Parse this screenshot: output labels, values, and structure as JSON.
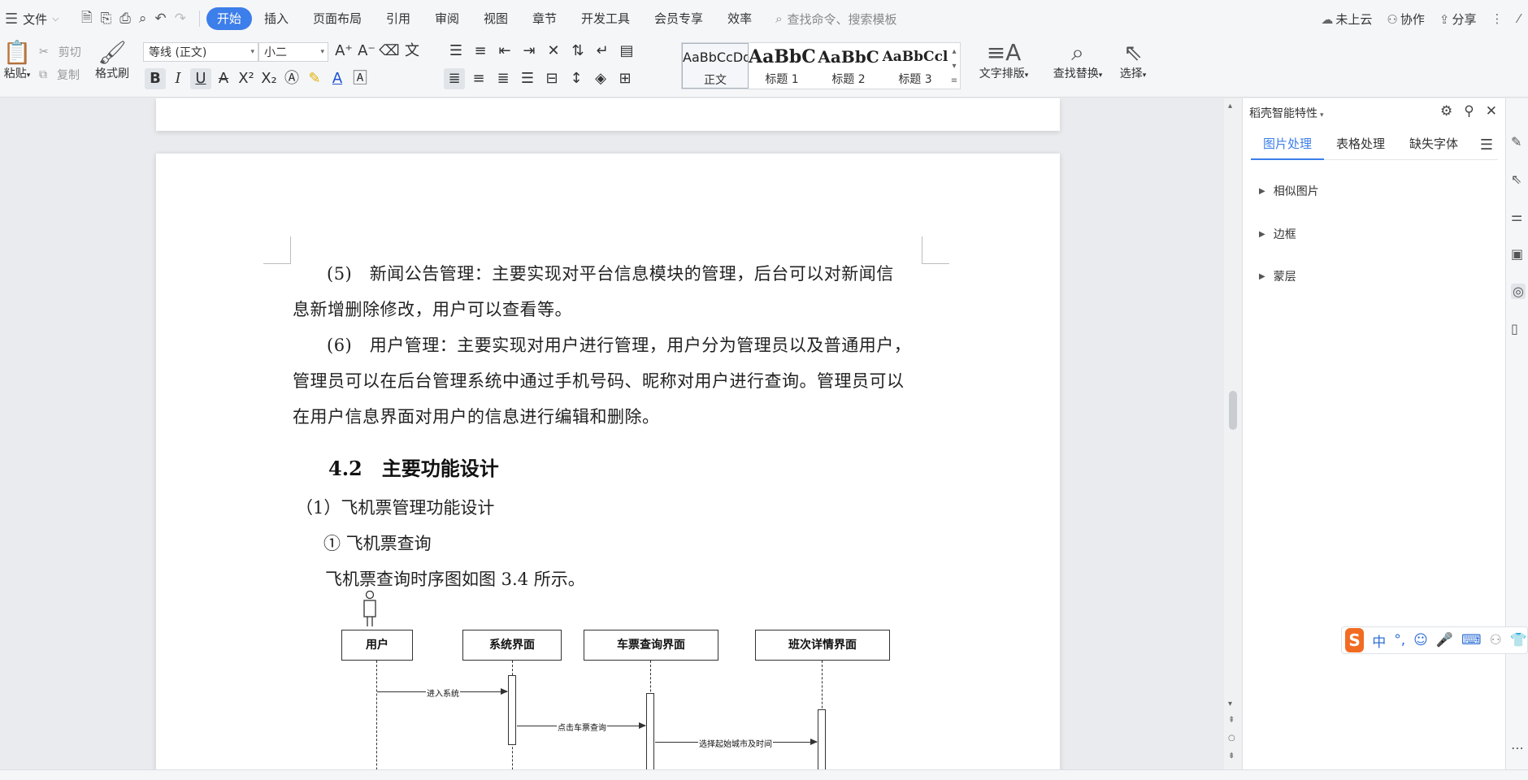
{
  "menubar": {
    "file_label": "文件",
    "tabs": [
      {
        "label": "开始",
        "active": true
      },
      {
        "label": "插入"
      },
      {
        "label": "页面布局"
      },
      {
        "label": "引用"
      },
      {
        "label": "审阅"
      },
      {
        "label": "视图"
      },
      {
        "label": "章节"
      },
      {
        "label": "开发工具"
      },
      {
        "label": "会员专享"
      },
      {
        "label": "效率"
      }
    ],
    "search_placeholder": "查找命令、搜索模板",
    "cloud_label": "未上云",
    "collab_label": "协作",
    "share_label": "分享"
  },
  "ribbon": {
    "paste_label": "粘贴",
    "cut_label": "剪切",
    "copy_label": "复制",
    "format_painter_label": "格式刷",
    "font_name": "等线 (正文)",
    "font_size": "小二",
    "styles": [
      {
        "preview": "AaBbCcDd",
        "name": "正文"
      },
      {
        "preview": "AaBbC",
        "name": "标题 1"
      },
      {
        "preview": "AaBbC",
        "name": "标题 2"
      },
      {
        "preview": "AaBbCcl",
        "name": "标题 3"
      }
    ],
    "text_layout_label": "文字排版",
    "find_replace_label": "查找替换",
    "select_label": "选择"
  },
  "document": {
    "p5_lines": [
      "(5)　新闻公告管理：主要实现对平台信息模块的管理，后台可以对新闻信",
      "息新增删除修改，用户可以查看等。"
    ],
    "p6_lines": [
      "(6)　用户管理：主要实现对用户进行管理，用户分为管理员以及普通用户，",
      "管理员可以在后台管理系统中通过手机号码、昵称对用户进行查询。管理员可以",
      "在用户信息界面对用户的信息进行编辑和删除。"
    ],
    "heading": "4.2　主要功能设计",
    "sub1": "（1）飞机票管理功能设计",
    "sub1_1": "① 飞机票查询",
    "caption_line": "飞机票查询时序图如图 3.4 所示。",
    "diagram": {
      "actors": [
        "用户",
        "系统界面",
        "车票查询界面",
        "班次详情界面"
      ],
      "messages": [
        "进入系统",
        "点击车票查询",
        "选择起始城市及时间"
      ]
    }
  },
  "panel": {
    "title": "稻壳智能特性",
    "tabs": [
      {
        "label": "图片处理",
        "active": true
      },
      {
        "label": "表格处理"
      },
      {
        "label": "缺失字体"
      }
    ],
    "items": [
      "相似图片",
      "边框",
      "蒙层"
    ]
  },
  "ime": {
    "logo": "S",
    "mode": "中"
  }
}
